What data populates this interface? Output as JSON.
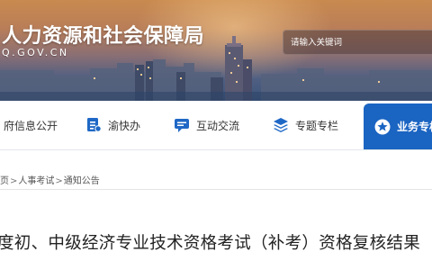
{
  "header": {
    "site_title": "人力资源和社会保障局",
    "site_url": "Q.GOV.CN",
    "search_placeholder": "请输入关键词"
  },
  "nav": {
    "items": [
      {
        "label": "府信息公开",
        "icon": "building-icon"
      },
      {
        "label": "渝快办",
        "icon": "document-icon"
      },
      {
        "label": "互动交流",
        "icon": "chat-icon"
      },
      {
        "label": "专题专栏",
        "icon": "layers-icon"
      },
      {
        "label": "业务专栏",
        "icon": "star-icon",
        "active": true
      }
    ]
  },
  "breadcrumb": {
    "items": [
      "页",
      "人事考试",
      "通知公告"
    ],
    "separator": ">"
  },
  "article": {
    "title": "度初、中级经济专业技术资格考试（补考）资格复核结果"
  },
  "colors": {
    "accent": "#1a64c2",
    "nav_icon_blue": "#1f68c6"
  }
}
